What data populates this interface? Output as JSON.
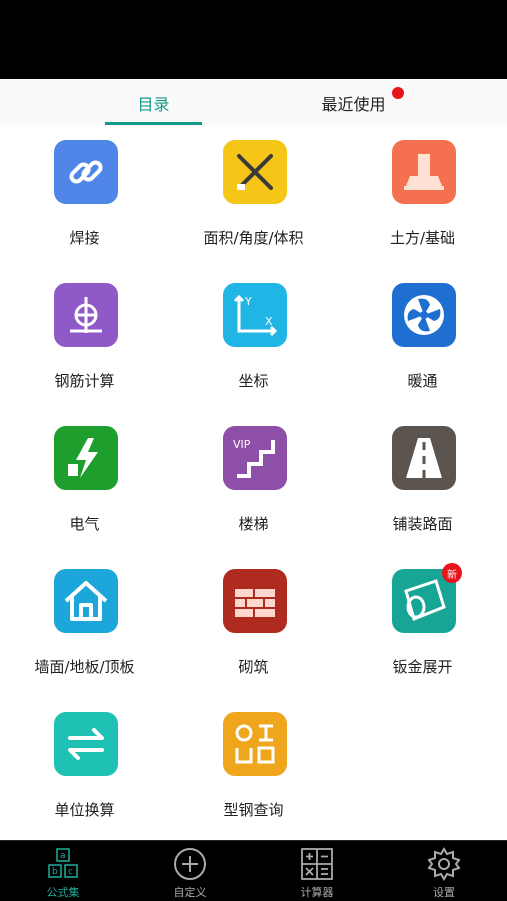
{
  "tabs": [
    {
      "label": "目录",
      "active": true
    },
    {
      "label": "最近使用",
      "active": false
    }
  ],
  "grid": [
    {
      "label": "焊接",
      "icon": "chain-link-icon",
      "color": "#4f86e8"
    },
    {
      "label": "面积/角度/体积",
      "icon": "ruler-pencil-icon",
      "color": "#f5c518"
    },
    {
      "label": "土方/基础",
      "icon": "foundation-icon",
      "color": "#f4704e"
    },
    {
      "label": "钢筋计算",
      "icon": "rebar-icon",
      "color": "#8f5ac7"
    },
    {
      "label": "坐标",
      "icon": "xy-axis-icon",
      "color": "#21b5e6"
    },
    {
      "label": "暖通",
      "icon": "fan-icon",
      "color": "#1f6fd0"
    },
    {
      "label": "电气",
      "icon": "electric-icon",
      "color": "#1d9e2d"
    },
    {
      "label": "楼梯",
      "icon": "stairs-icon",
      "color": "#8e4fa8",
      "vip": "VIP"
    },
    {
      "label": "铺装路面",
      "icon": "road-icon",
      "color": "#5c544f"
    },
    {
      "label": "墙面/地板/顶板",
      "icon": "house-icon",
      "color": "#1ca6d9"
    },
    {
      "label": "砌筑",
      "icon": "brick-wall-icon",
      "color": "#b02b1f"
    },
    {
      "label": "钣金展开",
      "icon": "sheet-metal-icon",
      "color": "#17a596",
      "badge": "新"
    },
    {
      "label": "单位换算",
      "icon": "swap-arrows-icon",
      "color": "#1fc1b4"
    },
    {
      "label": "型钢查询",
      "icon": "steel-profile-icon",
      "color": "#f0a61c"
    }
  ],
  "bottom_nav": [
    {
      "label": "公式集",
      "icon": "abc-blocks-icon",
      "active": true
    },
    {
      "label": "自定义",
      "icon": "plus-circle-icon",
      "active": false
    },
    {
      "label": "计算器",
      "icon": "calculator-icon",
      "active": false
    },
    {
      "label": "设置",
      "icon": "gear-icon",
      "active": false
    }
  ]
}
